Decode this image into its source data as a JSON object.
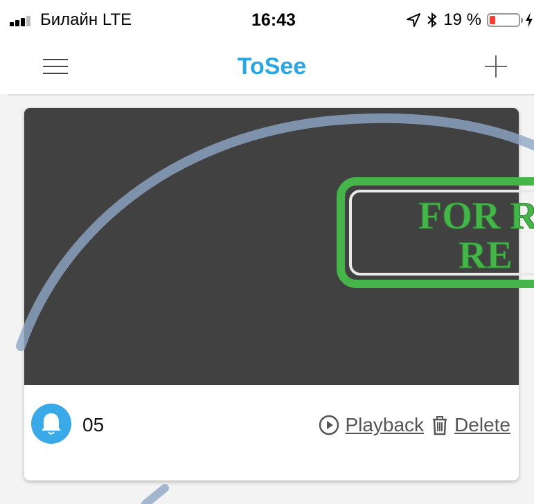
{
  "status_bar": {
    "carrier": "Билайн  LTE",
    "time": "16:43",
    "battery_text": "19 %",
    "battery_level": 0.19,
    "battery_color": "#ff3b30"
  },
  "nav": {
    "title": "ToSee",
    "title_color": "#2aa6e0"
  },
  "device": {
    "name": "05",
    "bell_color": "#3aa9e8"
  },
  "actions": {
    "playback_label": "Playback",
    "delete_label": "Delete"
  },
  "watermark": {
    "line1": "FOR R",
    "line2": "RE",
    "color": "#45b54a"
  }
}
